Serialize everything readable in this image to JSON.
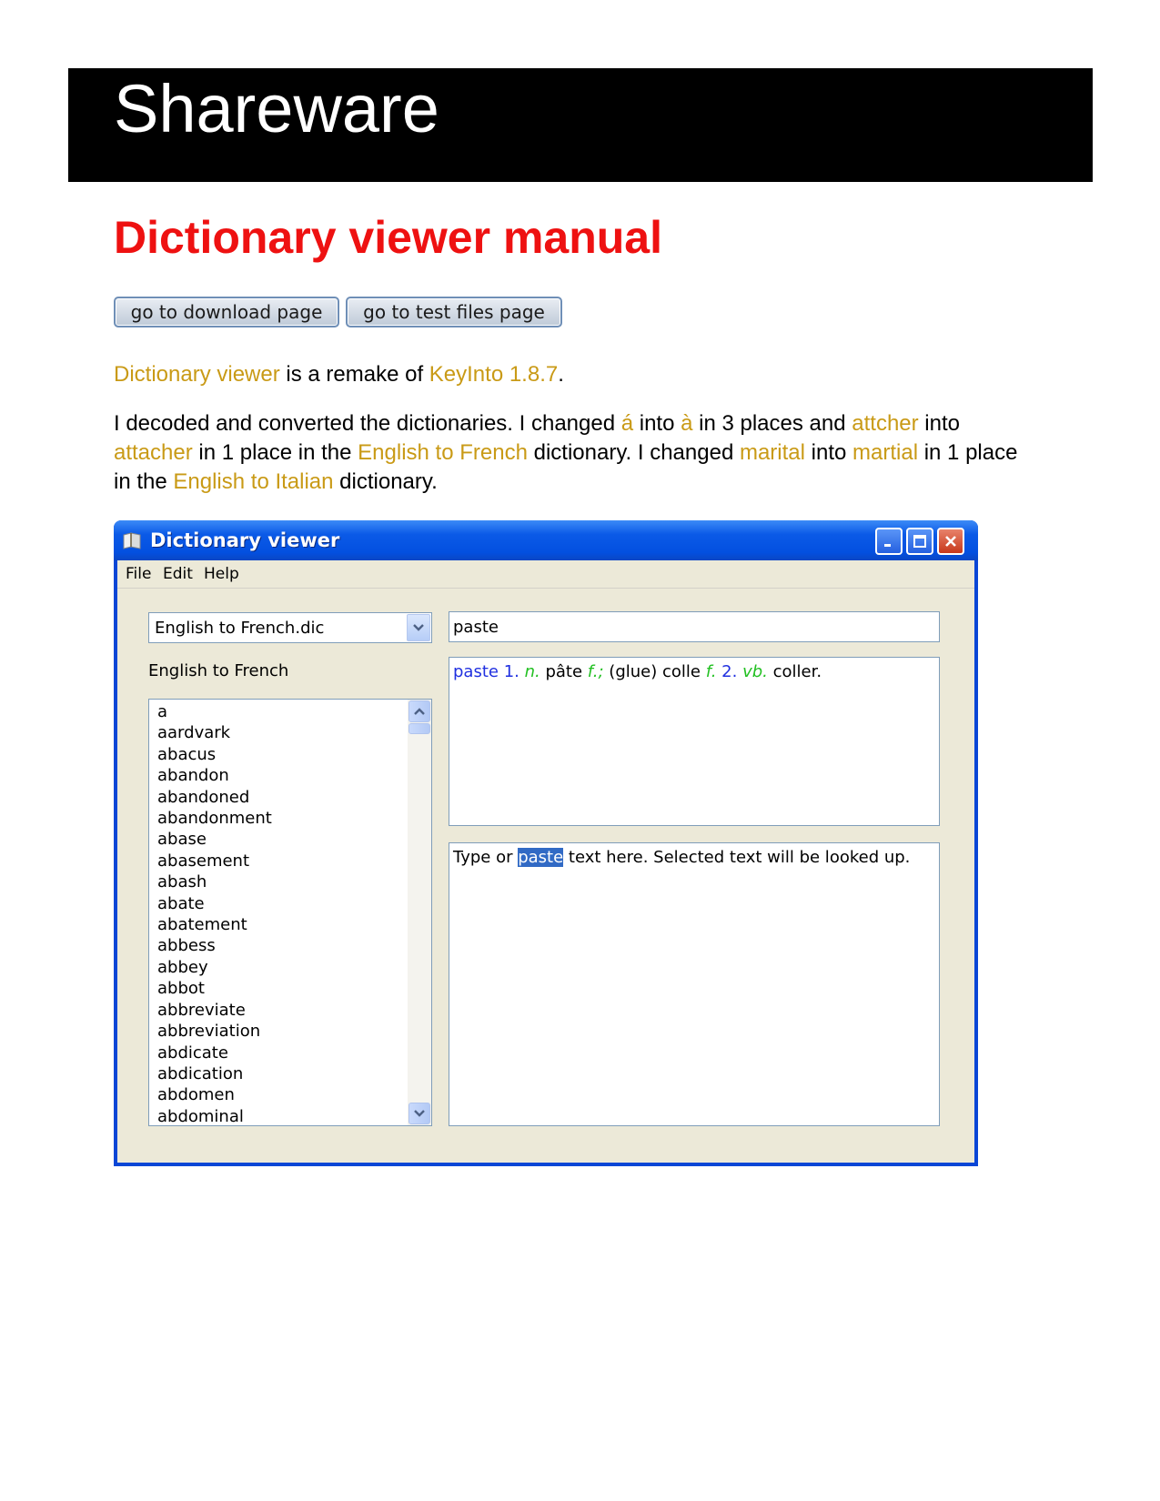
{
  "banner": {
    "title": "Shareware"
  },
  "page": {
    "title": "Dictionary viewer manual"
  },
  "nav": {
    "download_label": "go to download page",
    "test_files_label": "go to test files page"
  },
  "intro": {
    "link_dictionary_viewer": "Dictionary viewer",
    "text_is_remake": " is a remake of ",
    "link_keyinto": "KeyInto 1.8.7",
    "text_period": "."
  },
  "changes": {
    "t1": "I decoded and converted the dictionaries. I changed ",
    "l_a_acute": "á",
    "t2": " into ",
    "l_a_grave": "à",
    "t3": " in 3 places and ",
    "l_attcher": "attcher",
    "t4": " into ",
    "l_attacher": "attacher",
    "t5": " in 1 place in the ",
    "l_en_fr": "English to French",
    "t6": " dictionary. I changed ",
    "l_marital": "marital",
    "t7": " into ",
    "l_martial": "martial",
    "t8": " in 1 place in the ",
    "l_en_it": "English to Italian",
    "t9": " dictionary."
  },
  "window": {
    "title": "Dictionary viewer",
    "menu": {
      "file": "File",
      "edit": "Edit",
      "help": "Help"
    },
    "combo_value": "English to French.dic",
    "dict_label": "English to French",
    "words": [
      "a",
      "aardvark",
      "abacus",
      "abandon",
      "abandoned",
      "abandonment",
      "abase",
      "abasement",
      "abash",
      "abate",
      "abatement",
      "abbess",
      "abbey",
      "abbot",
      "abbreviate",
      "abbreviation",
      "abdicate",
      "abdication",
      "abdomen",
      "abdominal"
    ],
    "lookup_value": "paste",
    "definition": {
      "headword": "paste",
      "num1": " 1. ",
      "pos1": "n.",
      "w1": " pâte ",
      "g1": "f.;",
      "w2": " (glue) colle ",
      "g2": "f.",
      "num2": " 2. ",
      "pos2": "vb.",
      "w3": " coller."
    },
    "typebox": {
      "before": "Type or ",
      "selected": "paste",
      "after": " text here. Selected text will be looked up."
    }
  },
  "colors": {
    "link": "#c99a16",
    "title_red": "#ee1111",
    "headword_blue": "#2030e0",
    "grammar_green": "#22c022",
    "selection": "#316ac5"
  }
}
